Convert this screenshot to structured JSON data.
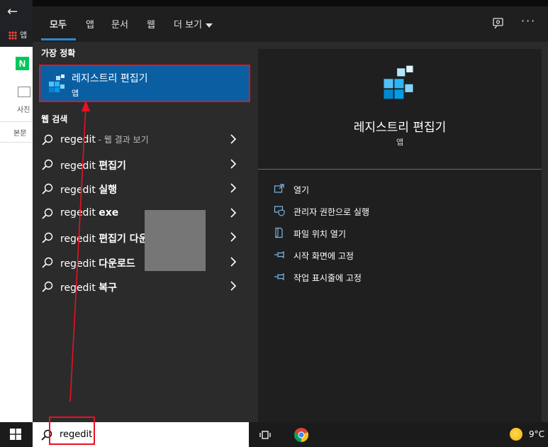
{
  "browser": {
    "bookmark_label": "앱",
    "naver_logo": "N",
    "photo_label": "사진",
    "text_label": "본문"
  },
  "tabs": [
    {
      "label": "모두",
      "active": true
    },
    {
      "label": "앱"
    },
    {
      "label": "문서"
    },
    {
      "label": "웹"
    },
    {
      "label": "더 보기"
    }
  ],
  "left": {
    "best_match_header": "가장 정확",
    "best_match": {
      "title": "레지스트리 편집기",
      "type": "앱",
      "icon": "registry-editor-icon"
    },
    "web_header": "웹 검색",
    "results": [
      {
        "query": "regedit",
        "suffix": "",
        "hint": " - 웹 결과 보기"
      },
      {
        "query": "regedit ",
        "suffix": "편집기",
        "hint": ""
      },
      {
        "query": "regedit ",
        "suffix": "실행",
        "hint": ""
      },
      {
        "query": "regedit ",
        "suffix": "exe",
        "hint": ""
      },
      {
        "query": "regedit ",
        "suffix": "편집기 다운",
        "hint": ""
      },
      {
        "query": "regedit ",
        "suffix": "다운로드",
        "hint": ""
      },
      {
        "query": "regedit ",
        "suffix": "복구",
        "hint": ""
      }
    ]
  },
  "right": {
    "title": "레지스트리 편집기",
    "subtitle": "앱",
    "actions": [
      {
        "label": "열기",
        "icon": "open-icon"
      },
      {
        "label": "관리자 권한으로 실행",
        "icon": "shield-icon"
      },
      {
        "label": "파일 위치 열기",
        "icon": "file-location-icon"
      },
      {
        "label": "시작 화면에 고정",
        "icon": "pin-icon"
      },
      {
        "label": "작업 표시줄에 고정",
        "icon": "pin-icon"
      }
    ]
  },
  "taskbar": {
    "search_value": "regedit",
    "temperature": "9°C"
  },
  "colors": {
    "accent": "#0a5fa3",
    "annotation": "#e81123",
    "panel": "#2b2b2b"
  }
}
